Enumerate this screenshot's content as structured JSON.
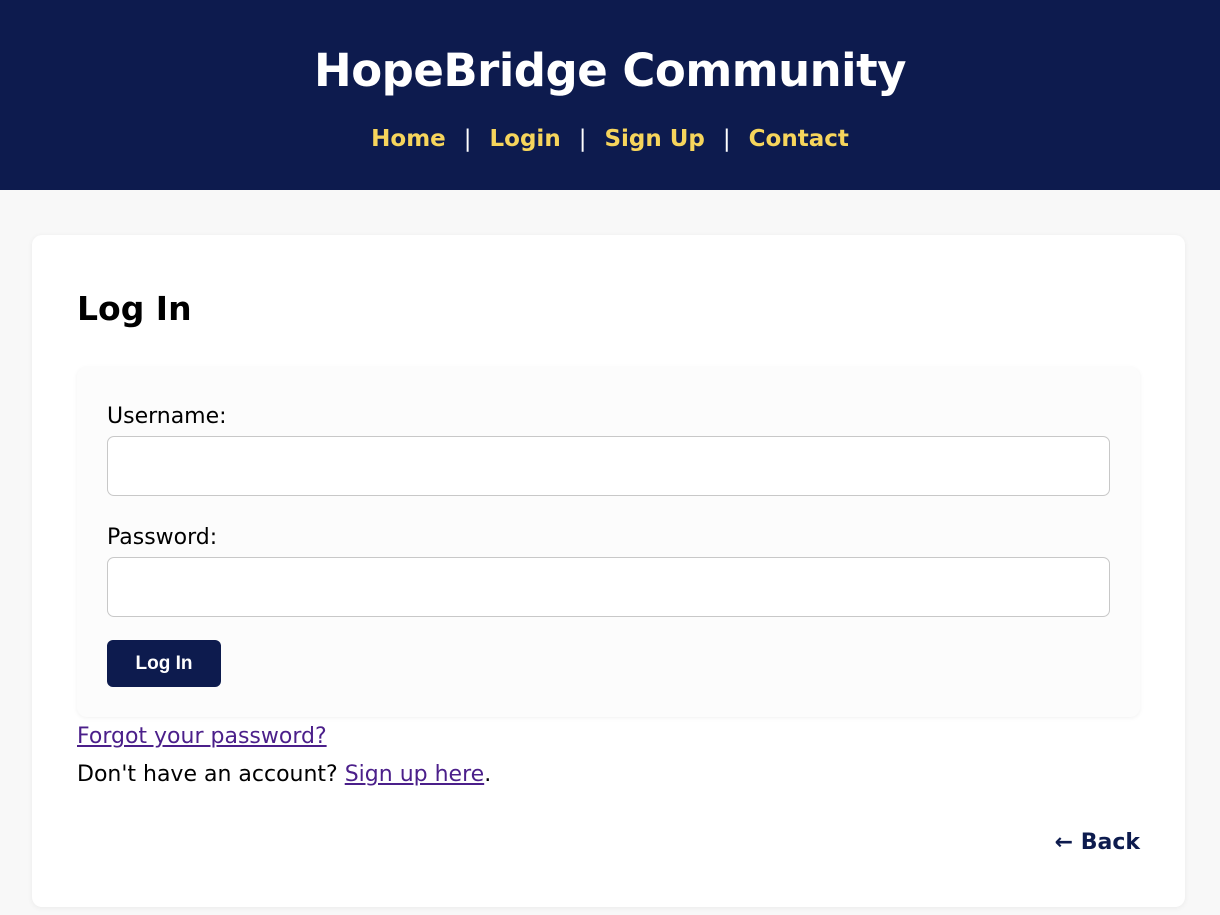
{
  "header": {
    "title": "HopeBridge Community",
    "nav": [
      {
        "label": "Home"
      },
      {
        "label": "Login"
      },
      {
        "label": "Sign Up"
      },
      {
        "label": "Contact"
      }
    ],
    "separator": "|"
  },
  "login": {
    "title": "Log In",
    "username_label": "Username:",
    "username_value": "",
    "password_label": "Password:",
    "password_value": "",
    "submit_label": "Log In",
    "forgot_link": "Forgot your password?",
    "signup_prompt": "Don't have an account? ",
    "signup_link": "Sign up here",
    "signup_suffix": ".",
    "back_label": "← Back"
  },
  "colors": {
    "header_bg": "#0d1b4e",
    "nav_link": "#f6d55c",
    "link": "#4b1f8a",
    "button_bg": "#0d1b4e"
  }
}
